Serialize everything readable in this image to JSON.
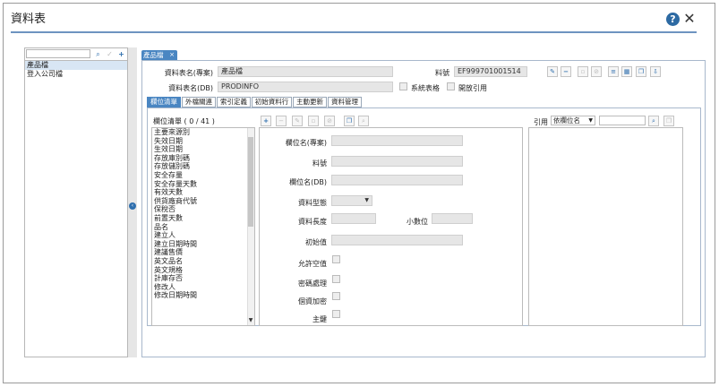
{
  "window": {
    "title": "資料表"
  },
  "left": {
    "search_placeholder": "",
    "items": [
      {
        "label": "產品檔"
      },
      {
        "label": "登入公司檔"
      }
    ]
  },
  "doc_tab": {
    "label": "產品檔",
    "close": "×"
  },
  "header": {
    "name_local_label": "資料表名(專案)",
    "name_local_value": "產品檔",
    "name_db_label": "資料表名(DB)",
    "name_db_value": "PRODINFO",
    "code_label": "料號",
    "code_value": "EF999701001514",
    "system_table_label": "系統表格",
    "open_ref_label": "開放引用"
  },
  "sub_tabs": [
    {
      "label": "欄位清單"
    },
    {
      "label": "外檔關連"
    },
    {
      "label": "索引定義"
    },
    {
      "label": "初始資料行"
    },
    {
      "label": "主動更新"
    },
    {
      "label": "資料管理"
    }
  ],
  "column_list": {
    "header": "欄位清單 ( 0 / 41 )",
    "items": [
      "主要來源別",
      "失效日期",
      "生效日期",
      "存放庫別碼",
      "存放儲別碼",
      "安全存量",
      "安全存量天數",
      "有效天數",
      "供貨廠商代號",
      "保稅否",
      "前置天數",
      "品名",
      "建立人",
      "建立日期時間",
      "建議售價",
      "英文品名",
      "英文規格",
      "計庫存否",
      "修改人",
      "修改日期時間"
    ]
  },
  "form": {
    "field_name_local": "欄位名(專案)",
    "field_code": "料號",
    "field_name_db": "欄位名(DB)",
    "data_type": "資料型態",
    "data_length": "資料長度",
    "decimals": "小數位",
    "initial_value": "初始值",
    "allow_null": "允許空值",
    "password": "密碼處理",
    "encrypt": "個資加密",
    "primary_key": "主鍵"
  },
  "ref": {
    "label": "引用",
    "select_value": "依欄位名"
  }
}
